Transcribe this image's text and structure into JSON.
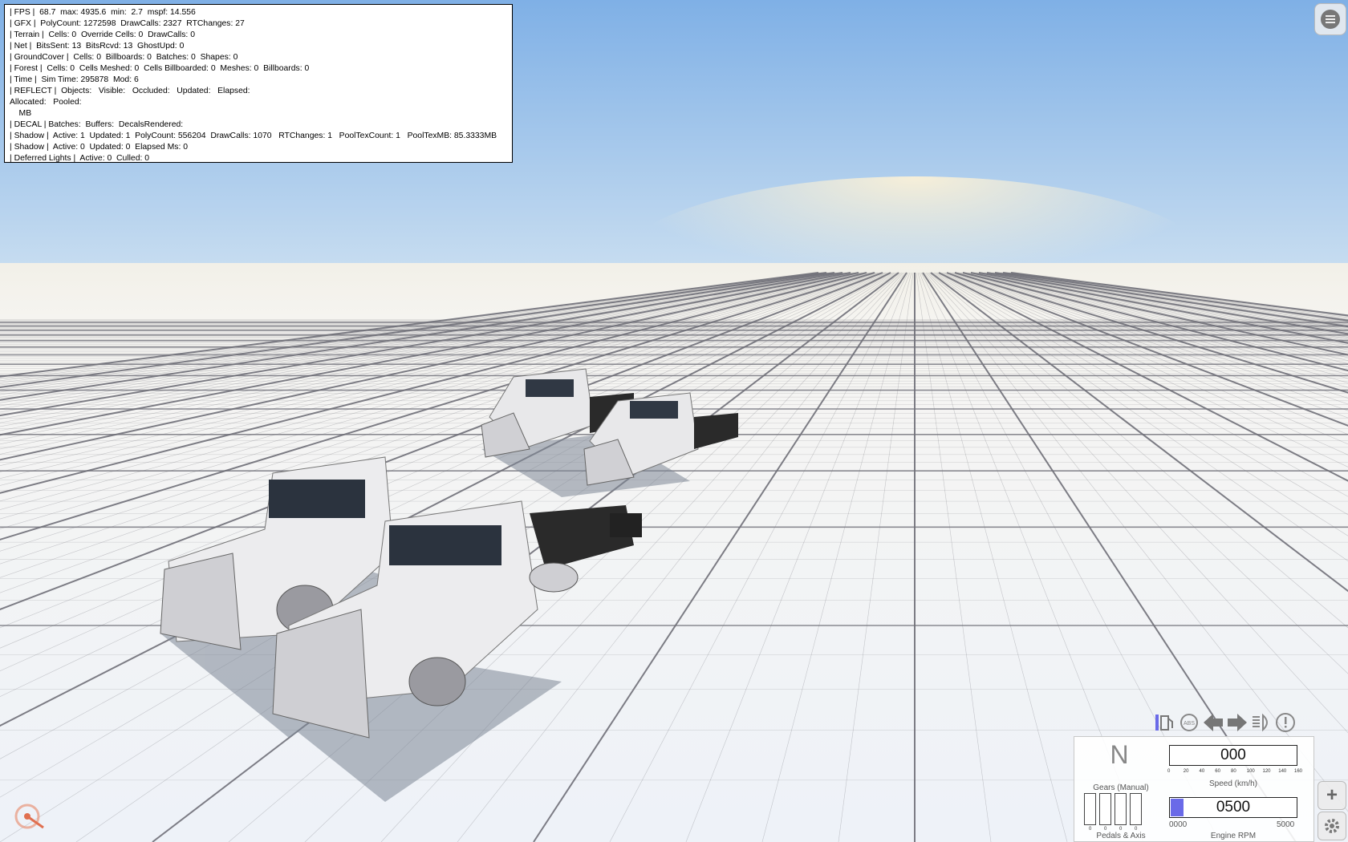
{
  "stats": [
    "| FPS |  68.7  max: 4935.6  min:  2.7  mspf: 14.556",
    "| GFX |  PolyCount: 1272598  DrawCalls: 2327  RTChanges: 27",
    "| Terrain |  Cells: 0  Override Cells: 0  DrawCalls: 0",
    "| Net |  BitsSent: 13  BitsRcvd: 13  GhostUpd: 0",
    "| GroundCover |  Cells: 0  Billboards: 0  Batches: 0  Shapes: 0",
    "| Forest |  Cells: 0  Cells Meshed: 0  Cells Billboarded: 0  Meshes: 0  Billboards: 0",
    "| Time |  Sim Time: 295878  Mod: 6",
    "| REFLECT |  Objects:   Visible:   Occluded:   Updated:   Elapsed:",
    "Allocated:   Pooled:",
    "    MB",
    "| DECAL | Batches:  Buffers:  DecalsRendered:",
    "| Shadow |  Active: 1  Updated: 1  PolyCount: 556204  DrawCalls: 1070   RTChanges: 1   PoolTexCount: 1   PoolTexMB: 85.3333MB",
    "| Shadow |  Active: 0  Updated: 0  Elapsed Ms: 0",
    "| Deferred Lights |  Active: 0  Culled: 0"
  ],
  "dashboard": {
    "gear": "N",
    "gears_label": "Gears (Manual)",
    "speed": "000",
    "speed_label": "Speed (km/h)",
    "speed_ticks": [
      "0",
      "20",
      "40",
      "60",
      "80",
      "100",
      "120",
      "140",
      "160"
    ],
    "rpm": "0500",
    "rpm_min": "0000",
    "rpm_max": "5000",
    "rpm_label": "Engine RPM",
    "rpm_fraction": 0.1,
    "pedals_label": "Pedals & Axis",
    "pedal_values": [
      "0",
      "0",
      "0",
      "0"
    ],
    "icons": [
      "fuel-icon",
      "abs-icon",
      "left-turn-signal-icon",
      "right-turn-signal-icon",
      "headlight-icon",
      "warning-icon"
    ],
    "accent": "#6a6ae8"
  },
  "colors": {
    "sky_top": "#7fb0e6",
    "horizon": "#f2f0e8",
    "grid_ground": "#f4f6fb"
  }
}
